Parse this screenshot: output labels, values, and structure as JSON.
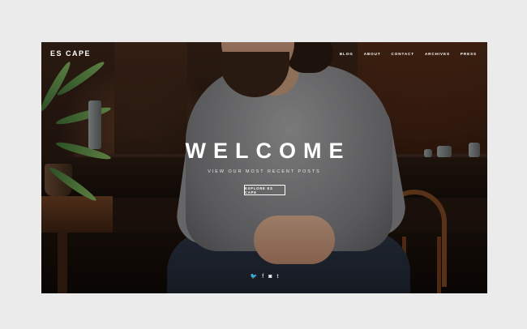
{
  "site": {
    "logo": "ES CAPE"
  },
  "nav": {
    "items": [
      "BLOG",
      "ABOUT",
      "CONTACT",
      "ARCHIVES",
      "PRESS"
    ]
  },
  "hero": {
    "title": "WELCOME",
    "subtitle": "VIEW OUR MOST RECENT POSTS",
    "button_label": "EXPLORE ES CAPE"
  },
  "social": {
    "icons": [
      "twitter-icon",
      "facebook-icon",
      "instagram-icon",
      "tumblr-icon"
    ],
    "glyphs": [
      "🐦",
      "f",
      "◙",
      "t"
    ]
  },
  "colors": {
    "page_background": "#ebebeb",
    "text": "#ffffff"
  }
}
